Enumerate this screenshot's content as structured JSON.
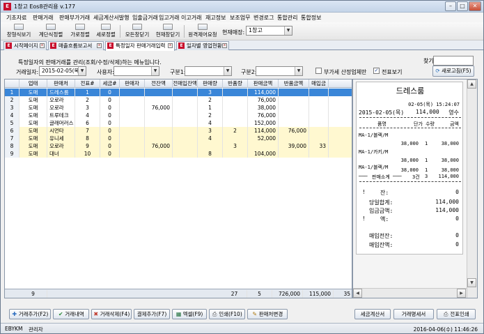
{
  "window": {
    "title": "1창고 Eos8관리용 v.177",
    "app_icon": "E"
  },
  "menu": [
    "기초자료",
    "판매거래",
    "판매부가거래",
    "세금계산서발행",
    "입출금거래",
    "입고거래",
    "이고거래",
    "재고정보",
    "보조업무",
    "변경로그",
    "통합관리",
    "통합정보"
  ],
  "toolbar": {
    "buttons": [
      "창형식보기",
      "계단식정렬",
      "가로정렬",
      "세로정렬",
      "모든창닫기",
      "현재창닫기",
      "원격제어요청"
    ],
    "store_label": "현재매장:",
    "store_value": "1창고"
  },
  "tabs": [
    {
      "label": "시작페이지"
    },
    {
      "label": "매출흐름보고서"
    },
    {
      "label": "특정일자 판매거래입력"
    },
    {
      "label": "일자별 영업현황"
    }
  ],
  "form": {
    "description": "특정일자의 판매거래를 관리(조회/수정/삭제)하는 메뉴입니다.",
    "find_label": "찾기:",
    "date_label": "거래일자:",
    "date_value": "2015-02-05(목)",
    "user_label": "사용자:",
    "type1_label": "구분1:",
    "type2_label": "구분2:",
    "vat_label": "부가세 산정업체만",
    "slip_label": "전표보기",
    "refresh_label": "새로고침(F5)"
  },
  "grid": {
    "columns": [
      "업태",
      "판매처",
      "전표#",
      "세금#",
      "판매자",
      "전잔액",
      "전매입잔액",
      "판매량",
      "반품량",
      "판매금액",
      "반품금액",
      "매입금"
    ],
    "rows": [
      {
        "no": "1",
        "cells": [
          "도매",
          "드레스룸",
          "1",
          "0",
          "",
          "",
          "",
          "3",
          "",
          "114,000",
          "",
          ""
        ]
      },
      {
        "no": "2",
        "cells": [
          "도매",
          "오로라",
          "2",
          "0",
          "",
          "",
          "",
          "2",
          "",
          "76,000",
          "",
          ""
        ]
      },
      {
        "no": "3",
        "cells": [
          "도매",
          "오로라",
          "3",
          "0",
          "",
          "76,000",
          "",
          "1",
          "",
          "38,000",
          "",
          ""
        ]
      },
      {
        "no": "4",
        "cells": [
          "도매",
          "트루테크",
          "4",
          "0",
          "",
          "",
          "",
          "2",
          "",
          "76,000",
          "",
          ""
        ]
      },
      {
        "no": "5",
        "cells": [
          "도매",
          "글래머러스",
          "6",
          "0",
          "",
          "",
          "",
          "4",
          "",
          "152,000",
          "",
          ""
        ]
      },
      {
        "no": "6",
        "cells": [
          "도매",
          "시먼타",
          "7",
          "0",
          "",
          "",
          "",
          "3",
          "2",
          "114,000",
          "76,000",
          ""
        ]
      },
      {
        "no": "7",
        "cells": [
          "도매",
          "유니세",
          "8",
          "0",
          "",
          "",
          "",
          "4",
          "",
          "52,000",
          "",
          ""
        ]
      },
      {
        "no": "8",
        "cells": [
          "도매",
          "오로라",
          "9",
          "0",
          "",
          "76,000",
          "",
          "",
          "3",
          "",
          "39,000",
          "33"
        ]
      },
      {
        "no": "9",
        "cells": [
          "도매",
          "대너",
          "10",
          "0",
          "",
          "",
          "",
          "8",
          "",
          "104,000",
          "",
          ""
        ]
      }
    ],
    "footer": {
      "count": "9",
      "qty": "27",
      "returns": "5",
      "amount": "726,000",
      "return_amount": "115,000",
      "purchase": "35"
    }
  },
  "receipt": {
    "store": "드레스룸",
    "datetime": "02-05(목) 15:24:07",
    "date": "2015-02-05(목)",
    "amount": "114,000",
    "doc": "영수",
    "col_item": "품명",
    "col_price_qty": "단가 수량",
    "col_amount": "금액",
    "items": [
      {
        "name": "MA-1/블랙/M",
        "price": "38,000",
        "qty": "1",
        "amount": "38,000"
      },
      {
        "name": "MA-1/카키/M",
        "price": "38,000",
        "qty": "1",
        "amount": "38,000"
      },
      {
        "name": "MA-1/블랙/M",
        "price": "38,000",
        "qty": "1",
        "amount": "38,000"
      }
    ],
    "subtotal_label": "판매소계",
    "subtotal_count": "3건",
    "subtotal_qty": "3",
    "subtotal_amount": "114,000",
    "balance_label": "잔:",
    "balance_value": "0",
    "today_total_label": "당일합계:",
    "today_total_value": "114,000",
    "deposit_label": "입금금액:",
    "deposit_value": "114,000",
    "amount_label": "액:",
    "amount_value": "0",
    "purchase_balance_label": "매입전잔:",
    "purchase_balance_value": "0",
    "purchase_remain_label": "매입잔액:",
    "purchase_remain_value": "0"
  },
  "bottom_buttons": {
    "add": "거래추가(F2)",
    "history": "거래내역",
    "delete": "거래삭제(F4)",
    "payment": "결제추가(F7)",
    "excel": "엑셀(F9)",
    "print": "인쇄(F10)",
    "change_seller": "판매처변경",
    "tax_invoice": "세금계산서",
    "statement": "거래명세서",
    "slip_print": "전표인쇄"
  },
  "status": {
    "user": "EBYKM",
    "role": "관리자",
    "datetime": "2016-04-06(수) 11:46:26"
  },
  "colors": {
    "selected_row": "#3a86d8",
    "highlight_row": "#fff8d0",
    "brand": "#c8102e"
  }
}
